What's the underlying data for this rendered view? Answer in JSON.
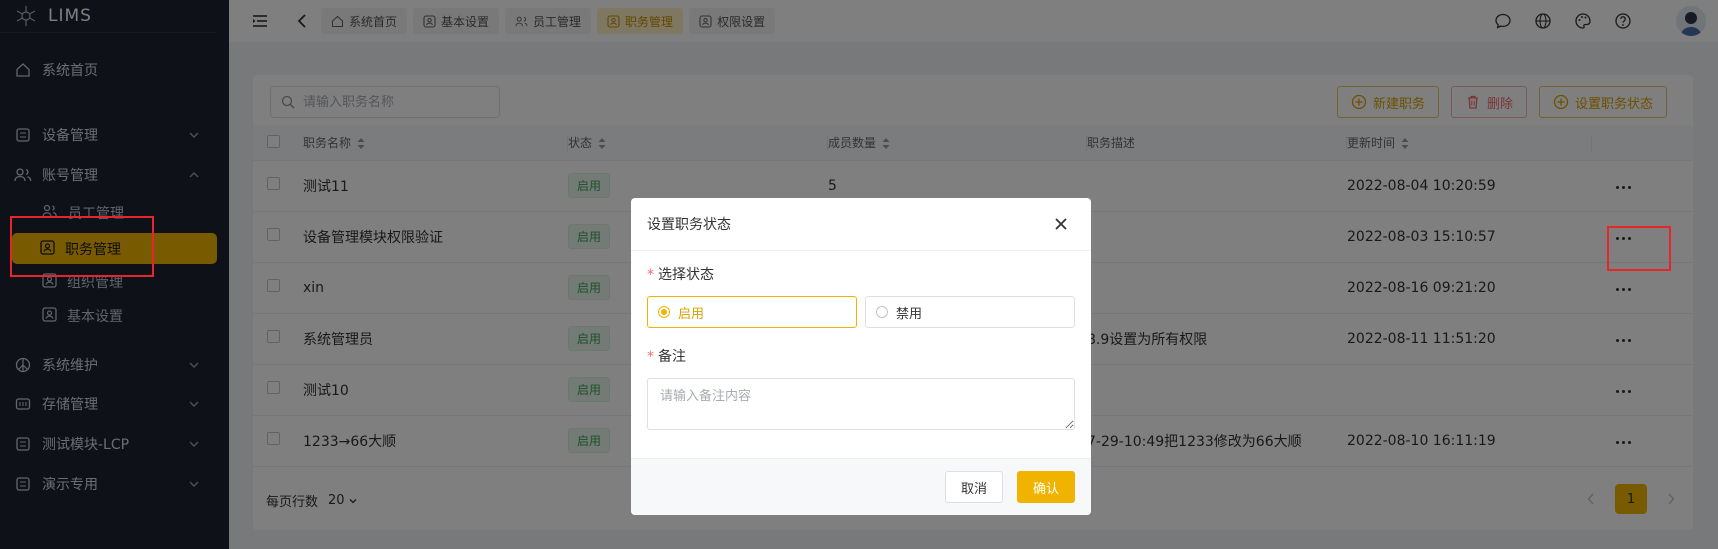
{
  "app": {
    "logo_text": "LIMS"
  },
  "sidebar": {
    "home": "系统首页",
    "device": "设备管理",
    "account": "账号管理",
    "sub": [
      "员工管理",
      "职务管理",
      "组织管理",
      "基本设置"
    ],
    "maint": "系统维护",
    "storage": "存储管理",
    "test_module": "测试模块-LCP",
    "demo": "演示专用"
  },
  "tabs": [
    {
      "label": "系统首页",
      "icon": "home-icon"
    },
    {
      "label": "基本设置",
      "icon": "user-card-icon"
    },
    {
      "label": "员工管理",
      "icon": "users-icon"
    },
    {
      "label": "职务管理",
      "icon": "user-card-icon",
      "active": true
    },
    {
      "label": "权限设置",
      "icon": "user-card-icon"
    }
  ],
  "toolbar": {
    "search_placeholder": "请输入职务名称",
    "new_label": "新建职务",
    "delete_label": "删除",
    "set_status_label": "设置职务状态"
  },
  "table": {
    "headers": [
      "职务名称",
      "状态",
      "成员数量",
      "职务描述",
      "更新时间"
    ],
    "rows": [
      {
        "name": "测试11",
        "status": "启用",
        "members": "5",
        "desc": "",
        "updated": "2022-08-04 10:20:59"
      },
      {
        "name": "设备管理模块权限验证",
        "status": "启用",
        "members": "",
        "desc": "",
        "updated": "2022-08-03 15:10:57"
      },
      {
        "name": "xin",
        "status": "启用",
        "members": "",
        "desc": "",
        "updated": "2022-08-16 09:21:20"
      },
      {
        "name": "系统管理员",
        "status": "启用",
        "members": "",
        "desc": "8.9设置为所有权限",
        "updated": "2022-08-11 11:51:20"
      },
      {
        "name": "测试10",
        "status": "启用",
        "members": "",
        "desc": "",
        "updated": ""
      },
      {
        "name": "1233→66大顺",
        "status": "启用",
        "members": "",
        "desc": "7-29-10:49把1233修改为66大顺",
        "updated": "2022-08-10 16:11:19"
      }
    ]
  },
  "footer": {
    "rows_per_page_label": "每页行数",
    "rows_per_page_value": "20",
    "current_page": "1"
  },
  "dialog": {
    "title": "设置职务状态",
    "status_label": "选择状态",
    "option_enable": "启用",
    "option_disable": "禁用",
    "remark_label": "备注",
    "remark_placeholder": "请输入备注内容",
    "cancel_label": "取消",
    "confirm_label": "确认"
  },
  "colors": {
    "accent": "#f0b400",
    "sidebar_bg": "#1e2330",
    "annotation": "#e5262b"
  }
}
